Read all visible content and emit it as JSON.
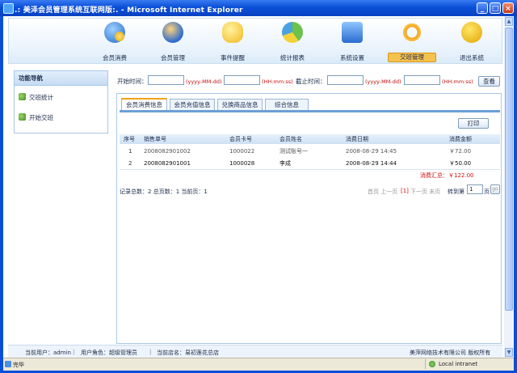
{
  "window": {
    "title": ".: 美泽会员管理系统互联网版:. - Microsoft Internet Explorer",
    "minimize": "_",
    "maximize": "□",
    "close": "×"
  },
  "topnav": {
    "items": [
      {
        "label": "会员消费",
        "icon": "coin-users-icon",
        "active": false
      },
      {
        "label": "会员管理",
        "icon": "users-icon",
        "active": false
      },
      {
        "label": "事件提醒",
        "icon": "chat-bubbles-icon",
        "active": false
      },
      {
        "label": "统计报表",
        "icon": "pie-chart-icon",
        "active": false
      },
      {
        "label": "系统设置",
        "icon": "settings-monitor-icon",
        "active": false
      },
      {
        "label": "交班管理",
        "icon": "refresh-arrows-icon",
        "active": true
      },
      {
        "label": "退出系统",
        "icon": "power-icon",
        "active": false
      }
    ]
  },
  "sidebar": {
    "header": "功能导航",
    "items": [
      {
        "label": "交班统计",
        "icon": "gear-icon"
      },
      {
        "label": "开始交班",
        "icon": "gear-icon"
      }
    ]
  },
  "search": {
    "start_label": "开始时间：",
    "date_hint": "(yyyy-MM-dd)",
    "time_hint": "(HH:mm:ss)",
    "end_label": "截止时间：",
    "date_hint2": "(yyyy-MM-dd)",
    "time_hint2": "(HH:mm:ss)",
    "query_button": "查看"
  },
  "tabs": [
    {
      "label": "会员消费信息",
      "active": true
    },
    {
      "label": "会员充值信息",
      "active": false
    },
    {
      "label": "兑换商品信息",
      "active": false
    },
    {
      "label": "综合信息",
      "active": false
    }
  ],
  "print_button": "打印",
  "table": {
    "columns": [
      "序号",
      "销售单号",
      "会员卡号",
      "会员姓名",
      "消费日期",
      "消费金额"
    ],
    "rows": [
      [
        "1",
        "2008082901002",
        "1000022",
        "测试账号一",
        "2008-08-29 14:45",
        "￥72.00"
      ],
      [
        "2",
        "2008082901001",
        "1000028",
        "李成",
        "2008-08-29 14:44",
        "￥50.00"
      ]
    ],
    "summary": "消费汇总：￥122.00"
  },
  "pager": {
    "info_total_label": "记录总数：",
    "total": "2",
    "info_pages_label": " 总页数：",
    "pages": "1",
    "info_current_label": " 当前页：",
    "current": "1",
    "nav_first_prev": "首页 上一页",
    "page_marker": "[1]",
    "nav_next_last": "下一页 末页",
    "goto_label": "转到第",
    "goto_value": "1",
    "page_unit": "页",
    "go_button": "go"
  },
  "footer": {
    "user": "当前用户：admin",
    "role": "用户角色：超级管理员",
    "store": "当前店名：易初莲花总店",
    "copyright": "美萍网络技术有限公司  版权所有"
  },
  "statusbar": {
    "status": "完毕",
    "zone": "Local intranet"
  }
}
